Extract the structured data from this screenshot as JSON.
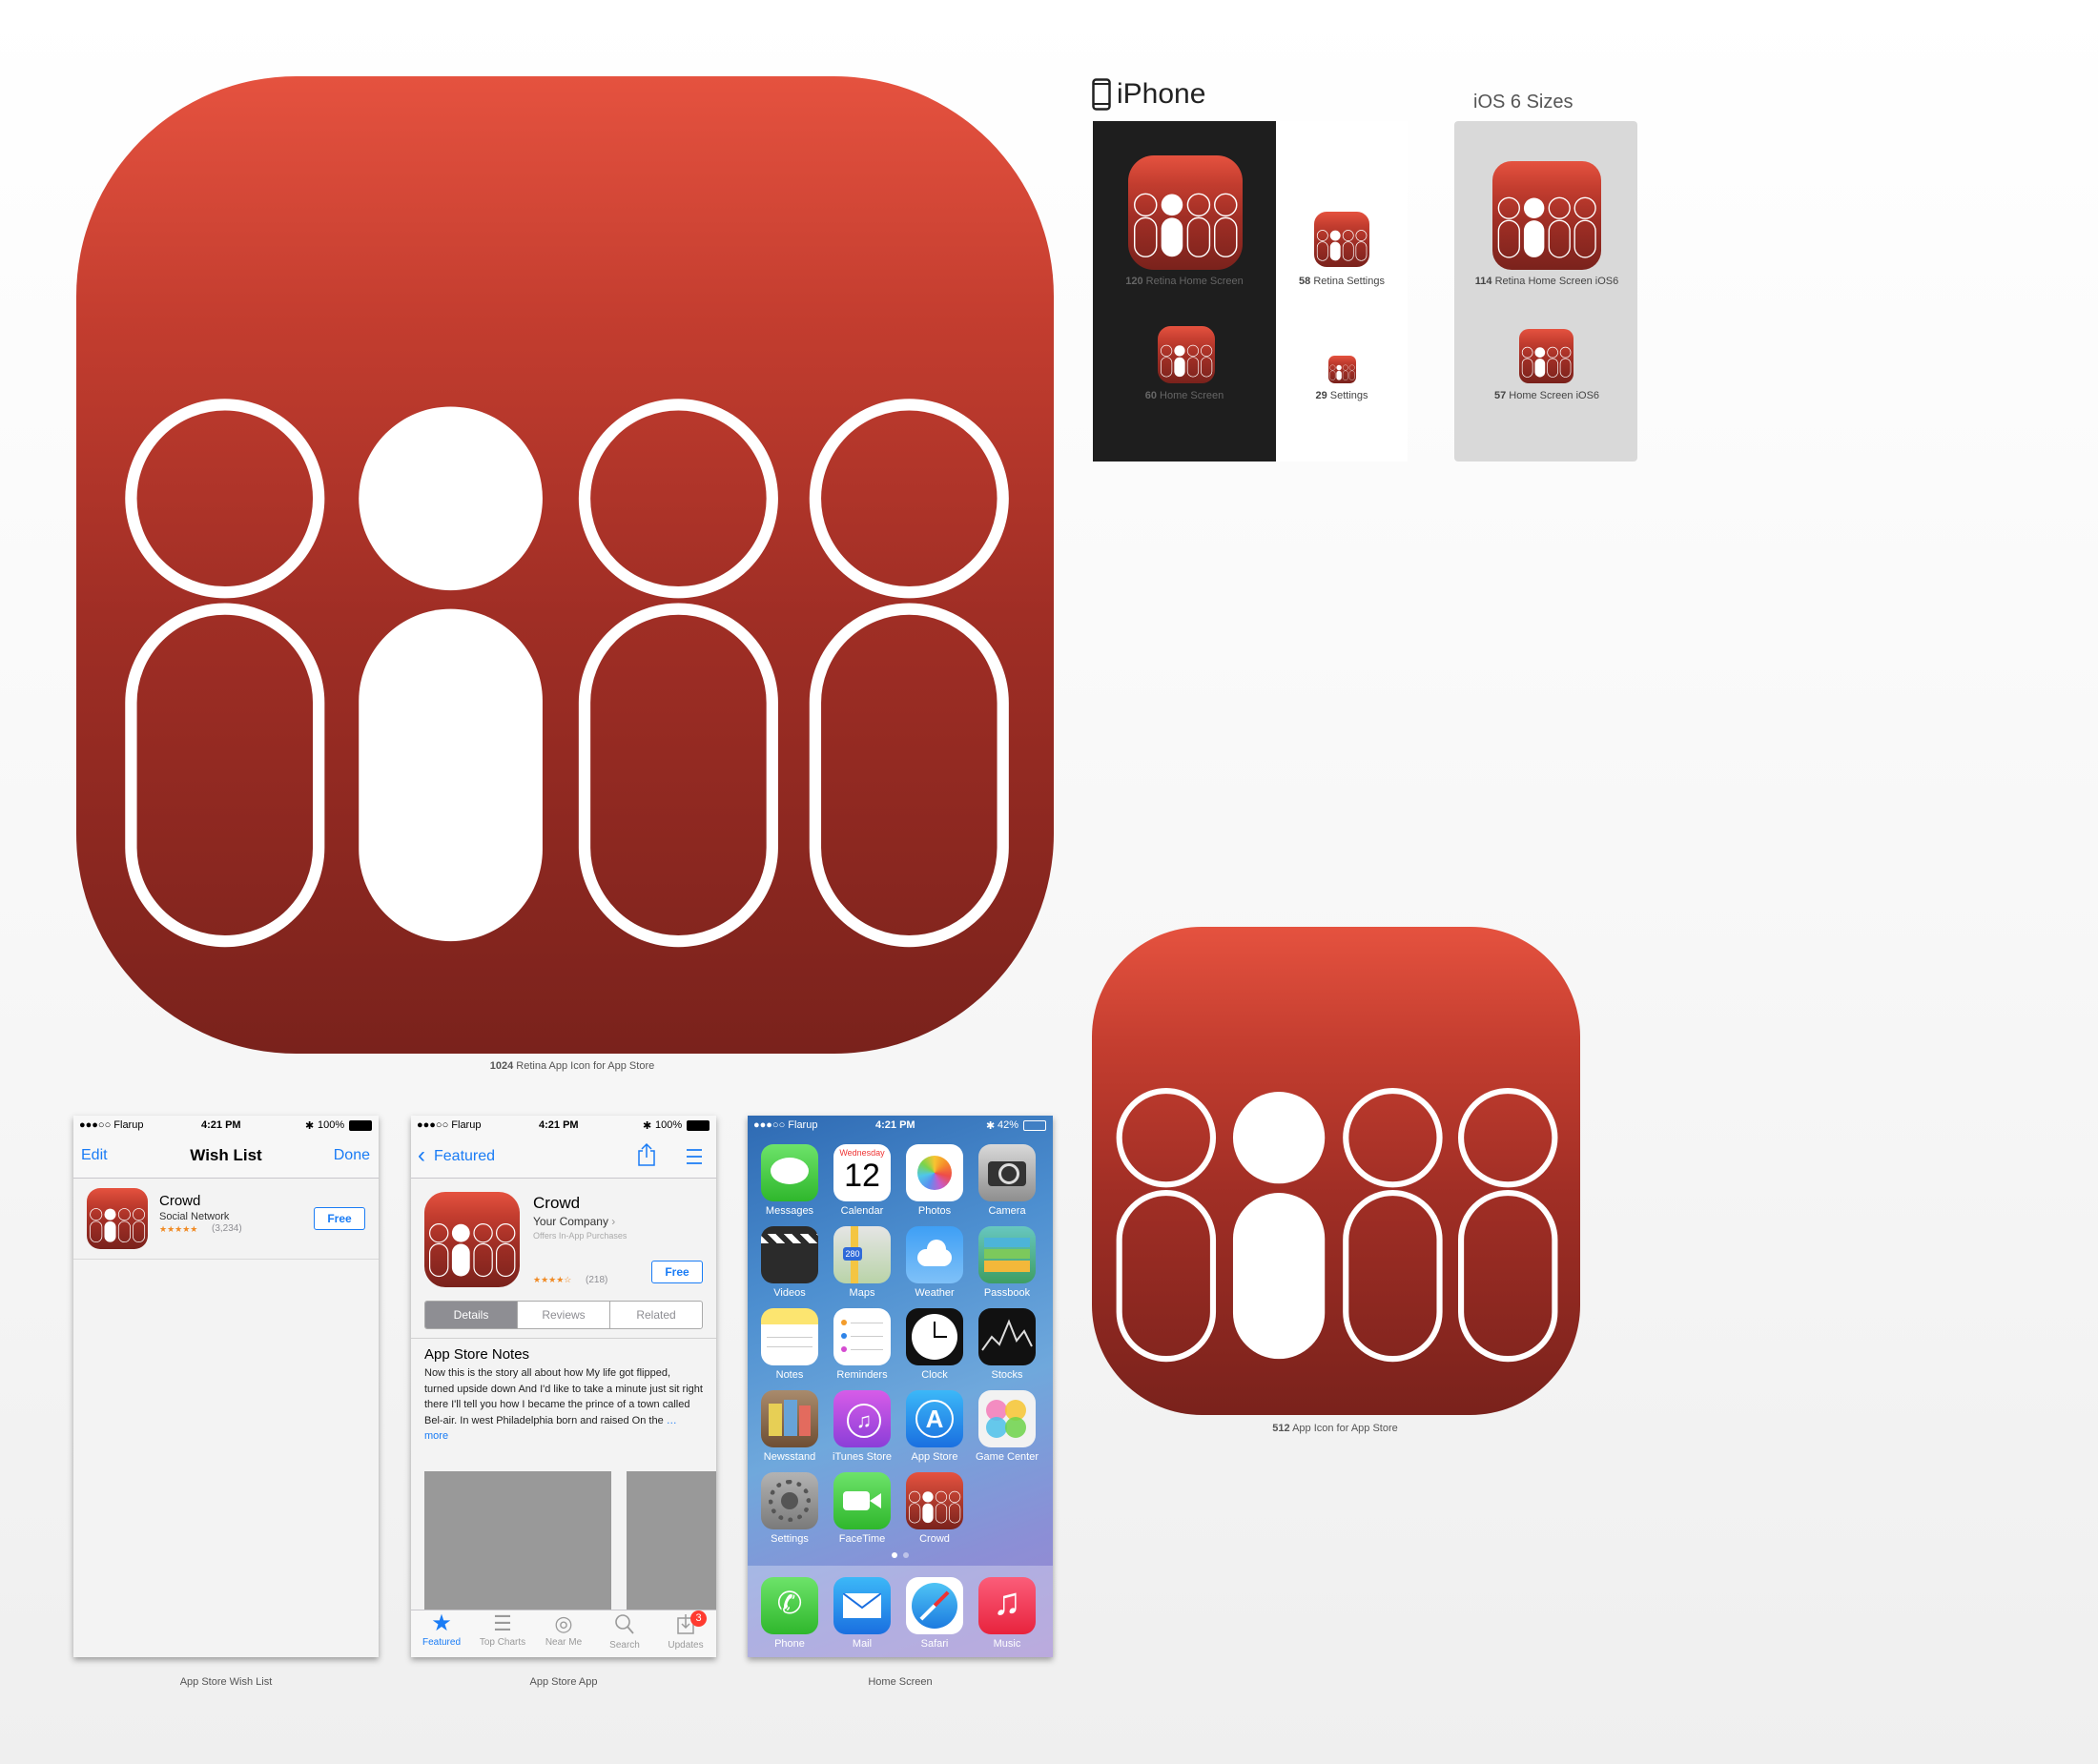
{
  "colors": {
    "icon_top": "#e5523f",
    "icon_bottom": "#7a221c",
    "ios_blue": "#1a7cf5"
  },
  "captions": {
    "large_icon": {
      "size": "1024",
      "label": "Retina App Icon for App Store"
    },
    "medium_icon": {
      "size": "512",
      "label": "App Icon for App Store"
    },
    "wish_list": "App Store Wish List",
    "app_store_app": "App Store App",
    "home_screen": "Home Screen"
  },
  "iphone_section": {
    "title": "iPhone",
    "icons": [
      {
        "size": "120",
        "label": "Retina Home Screen"
      },
      {
        "size": "58",
        "label": "Retina Settings"
      },
      {
        "size": "60",
        "label": "Home Screen"
      },
      {
        "size": "29",
        "label": "Settings"
      }
    ]
  },
  "ios6_section": {
    "title": "iOS 6 Sizes",
    "icons": [
      {
        "size": "114",
        "label": "Retina Home Screen iOS6"
      },
      {
        "size": "57",
        "label": "Home Screen iOS6"
      }
    ]
  },
  "status_bar": {
    "carrier": "●●●○○ Flarup",
    "time": "4:21 PM",
    "battery": "100%",
    "battery_home": "42%"
  },
  "wish_list_screen": {
    "edit": "Edit",
    "title": "Wish List",
    "done": "Done",
    "app_name": "Crowd",
    "category": "Social Network",
    "stars": "★★★★★",
    "rating_count": "(3,234)",
    "price": "Free"
  },
  "app_store_screen": {
    "back": "Featured",
    "app_name": "Crowd",
    "company": "Your Company",
    "chevron": "›",
    "iap": "Offers In-App Purchases",
    "stars": "★★★★☆",
    "rating_count": "(218)",
    "price": "Free",
    "segments": [
      "Details",
      "Reviews",
      "Related"
    ],
    "notes_title": "App Store Notes",
    "notes_text": "Now this is the story all about how My life got flipped, turned upside down And I'd like to take a minute just sit right there I'll tell you how I became the prince of a town called Bel-air. In west Philadelphia born and raised On the",
    "more": "… more",
    "tabs": [
      "Featured",
      "Top Charts",
      "Near Me",
      "Search",
      "Updates"
    ],
    "updates_badge": "3"
  },
  "home_screen": {
    "apps": [
      "Messages",
      "Calendar",
      "Photos",
      "Camera",
      "Videos",
      "Maps",
      "Weather",
      "Passbook",
      "Notes",
      "Reminders",
      "Clock",
      "Stocks",
      "Newsstand",
      "iTunes Store",
      "App Store",
      "Game Center",
      "Settings",
      "FaceTime",
      "Crowd"
    ],
    "calendar_day": "Wednesday",
    "calendar_date": "12",
    "dock": [
      "Phone",
      "Mail",
      "Safari",
      "Music"
    ]
  }
}
